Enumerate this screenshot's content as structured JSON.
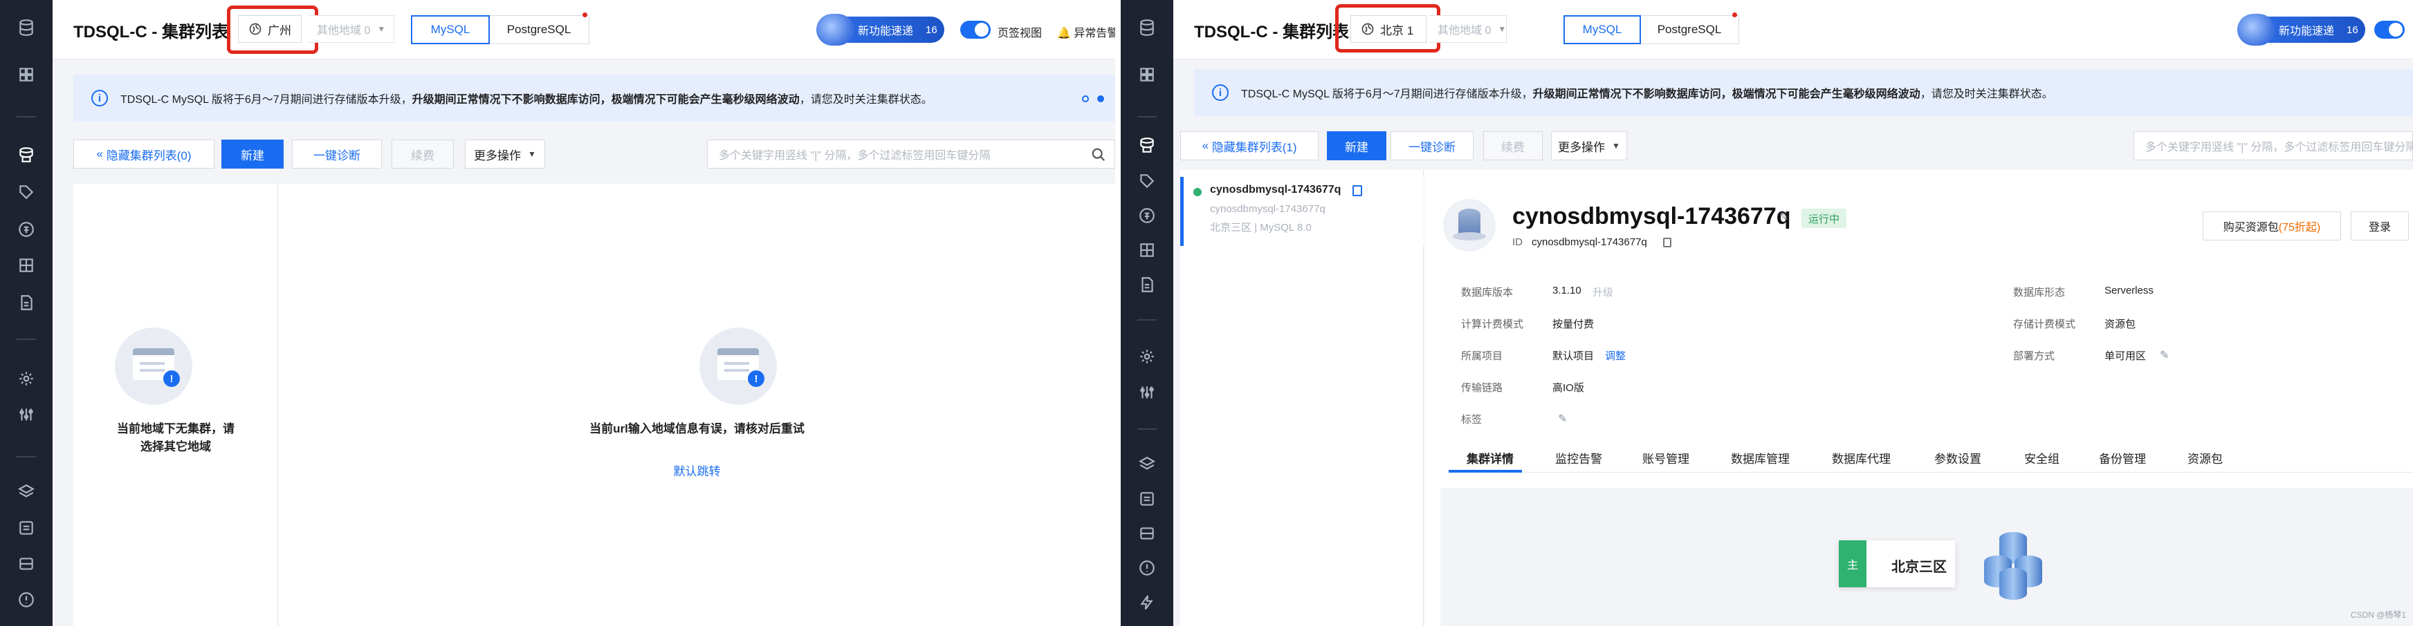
{
  "left": {
    "header": {
      "title": "TDSQL-C - 集群列表",
      "region": "广州",
      "other_region": "其他地域 0",
      "tabs": [
        {
          "label": "MySQL"
        },
        {
          "label": "PostgreSQL"
        }
      ],
      "promo": {
        "label": "新功能速递",
        "count": "16"
      },
      "toggle_label": "页签视图",
      "alarm_label": "异常告警"
    },
    "notice": {
      "prefix": "TDSQL-C MySQL 版将于6月～7月期间进行存储版本升级，",
      "bold": "升级期间正常情况下不影响数据库访问，极端情况下可能会产生毫秒级网络波动",
      "suffix": "，请您及时关注集群状态。"
    },
    "toolbar": {
      "hide_list": "隐藏集群列表(0)",
      "create": "新建",
      "diagnose": "一键诊断",
      "renew": "续费",
      "more": "更多操作",
      "search_placeholder": "多个关键字用竖线 \"|\" 分隔，多个过滤标签用回车键分隔"
    },
    "empty_list": {
      "line1": "当前地域下无集群，请",
      "line2": "选择其它地域"
    },
    "empty_detail": {
      "text": "当前url输入地域信息有误，请核对后重试",
      "link": "默认跳转"
    }
  },
  "right": {
    "header": {
      "title": "TDSQL-C - 集群列表",
      "region": "北京 1",
      "other_region": "其他地域 0",
      "tabs": [
        {
          "label": "MySQL"
        },
        {
          "label": "PostgreSQL"
        }
      ],
      "promo": {
        "label": "新功能速递",
        "count": "16"
      }
    },
    "notice": {
      "prefix": "TDSQL-C MySQL 版将于6月～7月期间进行存储版本升级，",
      "bold": "升级期间正常情况下不影响数据库访问，极端情况下可能会产生毫秒级网络波动",
      "suffix": "，请您及时关注集群状态。"
    },
    "toolbar": {
      "hide_list": "隐藏集群列表(1)",
      "create": "新建",
      "diagnose": "一键诊断",
      "renew": "续费",
      "more": "更多操作",
      "search_placeholder": "多个关键字用竖线 \"|\" 分隔，多个过滤标签用回车键分隔"
    },
    "cluster_item": {
      "name": "cynosdbmysql-1743677q",
      "id": "cynosdbmysql-1743677q",
      "meta": "北京三区 | MySQL 8.0"
    },
    "detail": {
      "title": "cynosdbmysql-1743677q",
      "status": "运行中",
      "id_label": "ID",
      "id_value": "cynosdbmysql-1743677q",
      "buy_button": {
        "prefix": "购买资源包",
        "discount": "(75折起)"
      },
      "login_button": "登录",
      "fields_left": [
        {
          "label": "数据库版本",
          "value": "3.1.10",
          "extra": "升级"
        },
        {
          "label": "计算计费模式",
          "value": "按量付费"
        },
        {
          "label": "所属项目",
          "value": "默认项目",
          "link": "调整"
        },
        {
          "label": "传输链路",
          "value": "高IO版"
        },
        {
          "label": "标签",
          "value": ""
        }
      ],
      "fields_right": [
        {
          "label": "数据库形态",
          "value": "Serverless"
        },
        {
          "label": "存储计费模式",
          "value": "资源包"
        },
        {
          "label": "部署方式",
          "value": "单可用区"
        }
      ],
      "tabs": [
        "集群详情",
        "监控告警",
        "账号管理",
        "数据库管理",
        "数据库代理",
        "参数设置",
        "安全组",
        "备份管理",
        "资源包"
      ],
      "zone": {
        "tag": "主",
        "name": "北京三区"
      }
    },
    "watermark": "CSDN @杨琴1"
  },
  "colors": {
    "primary": "#1a6df0",
    "highlight": "#e0281d",
    "success": "#2fb170",
    "sidebar": "#1d2330"
  }
}
